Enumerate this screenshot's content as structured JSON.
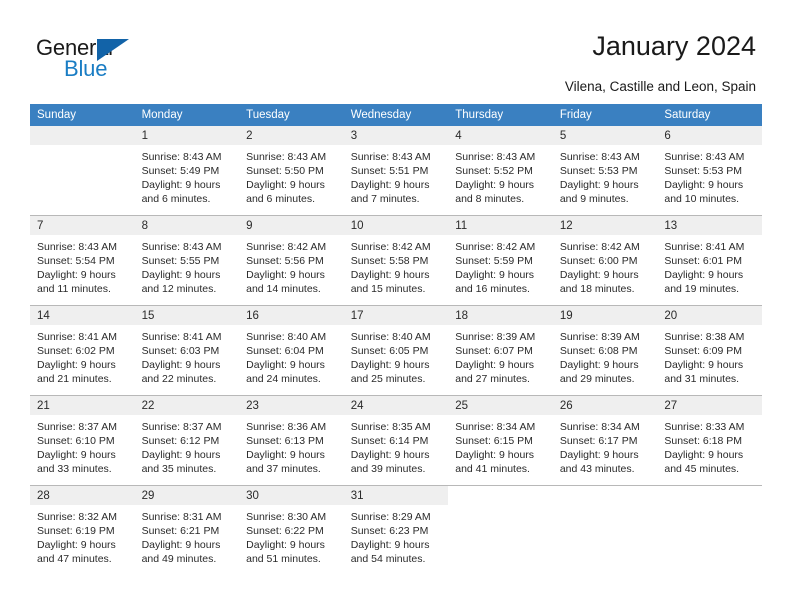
{
  "brand": {
    "name_part1": "General",
    "name_part2": "Blue",
    "triangle_color": "#1263a8",
    "blue_color": "#1a7dc4"
  },
  "header": {
    "title": "January 2024",
    "subtitle": "Vilena, Castille and Leon, Spain"
  },
  "theme": {
    "header_row_bg": "#3a80c1",
    "daynum_bg": "#efefef",
    "grid_line": "#b8b8b8",
    "text": "#2a2a2a"
  },
  "weekdays": [
    "Sunday",
    "Monday",
    "Tuesday",
    "Wednesday",
    "Thursday",
    "Friday",
    "Saturday"
  ],
  "weeks": [
    [
      {
        "day": "",
        "detail": "",
        "empty": true
      },
      {
        "day": "1",
        "detail": "Sunrise: 8:43 AM\nSunset: 5:49 PM\nDaylight: 9 hours\nand 6 minutes."
      },
      {
        "day": "2",
        "detail": "Sunrise: 8:43 AM\nSunset: 5:50 PM\nDaylight: 9 hours\nand 6 minutes."
      },
      {
        "day": "3",
        "detail": "Sunrise: 8:43 AM\nSunset: 5:51 PM\nDaylight: 9 hours\nand 7 minutes."
      },
      {
        "day": "4",
        "detail": "Sunrise: 8:43 AM\nSunset: 5:52 PM\nDaylight: 9 hours\nand 8 minutes."
      },
      {
        "day": "5",
        "detail": "Sunrise: 8:43 AM\nSunset: 5:53 PM\nDaylight: 9 hours\nand 9 minutes."
      },
      {
        "day": "6",
        "detail": "Sunrise: 8:43 AM\nSunset: 5:53 PM\nDaylight: 9 hours\nand 10 minutes."
      }
    ],
    [
      {
        "day": "7",
        "detail": "Sunrise: 8:43 AM\nSunset: 5:54 PM\nDaylight: 9 hours\nand 11 minutes."
      },
      {
        "day": "8",
        "detail": "Sunrise: 8:43 AM\nSunset: 5:55 PM\nDaylight: 9 hours\nand 12 minutes."
      },
      {
        "day": "9",
        "detail": "Sunrise: 8:42 AM\nSunset: 5:56 PM\nDaylight: 9 hours\nand 14 minutes."
      },
      {
        "day": "10",
        "detail": "Sunrise: 8:42 AM\nSunset: 5:58 PM\nDaylight: 9 hours\nand 15 minutes."
      },
      {
        "day": "11",
        "detail": "Sunrise: 8:42 AM\nSunset: 5:59 PM\nDaylight: 9 hours\nand 16 minutes."
      },
      {
        "day": "12",
        "detail": "Sunrise: 8:42 AM\nSunset: 6:00 PM\nDaylight: 9 hours\nand 18 minutes."
      },
      {
        "day": "13",
        "detail": "Sunrise: 8:41 AM\nSunset: 6:01 PM\nDaylight: 9 hours\nand 19 minutes."
      }
    ],
    [
      {
        "day": "14",
        "detail": "Sunrise: 8:41 AM\nSunset: 6:02 PM\nDaylight: 9 hours\nand 21 minutes."
      },
      {
        "day": "15",
        "detail": "Sunrise: 8:41 AM\nSunset: 6:03 PM\nDaylight: 9 hours\nand 22 minutes."
      },
      {
        "day": "16",
        "detail": "Sunrise: 8:40 AM\nSunset: 6:04 PM\nDaylight: 9 hours\nand 24 minutes."
      },
      {
        "day": "17",
        "detail": "Sunrise: 8:40 AM\nSunset: 6:05 PM\nDaylight: 9 hours\nand 25 minutes."
      },
      {
        "day": "18",
        "detail": "Sunrise: 8:39 AM\nSunset: 6:07 PM\nDaylight: 9 hours\nand 27 minutes."
      },
      {
        "day": "19",
        "detail": "Sunrise: 8:39 AM\nSunset: 6:08 PM\nDaylight: 9 hours\nand 29 minutes."
      },
      {
        "day": "20",
        "detail": "Sunrise: 8:38 AM\nSunset: 6:09 PM\nDaylight: 9 hours\nand 31 minutes."
      }
    ],
    [
      {
        "day": "21",
        "detail": "Sunrise: 8:37 AM\nSunset: 6:10 PM\nDaylight: 9 hours\nand 33 minutes."
      },
      {
        "day": "22",
        "detail": "Sunrise: 8:37 AM\nSunset: 6:12 PM\nDaylight: 9 hours\nand 35 minutes."
      },
      {
        "day": "23",
        "detail": "Sunrise: 8:36 AM\nSunset: 6:13 PM\nDaylight: 9 hours\nand 37 minutes."
      },
      {
        "day": "24",
        "detail": "Sunrise: 8:35 AM\nSunset: 6:14 PM\nDaylight: 9 hours\nand 39 minutes."
      },
      {
        "day": "25",
        "detail": "Sunrise: 8:34 AM\nSunset: 6:15 PM\nDaylight: 9 hours\nand 41 minutes."
      },
      {
        "day": "26",
        "detail": "Sunrise: 8:34 AM\nSunset: 6:17 PM\nDaylight: 9 hours\nand 43 minutes."
      },
      {
        "day": "27",
        "detail": "Sunrise: 8:33 AM\nSunset: 6:18 PM\nDaylight: 9 hours\nand 45 minutes."
      }
    ],
    [
      {
        "day": "28",
        "detail": "Sunrise: 8:32 AM\nSunset: 6:19 PM\nDaylight: 9 hours\nand 47 minutes."
      },
      {
        "day": "29",
        "detail": "Sunrise: 8:31 AM\nSunset: 6:21 PM\nDaylight: 9 hours\nand 49 minutes."
      },
      {
        "day": "30",
        "detail": "Sunrise: 8:30 AM\nSunset: 6:22 PM\nDaylight: 9 hours\nand 51 minutes."
      },
      {
        "day": "31",
        "detail": "Sunrise: 8:29 AM\nSunset: 6:23 PM\nDaylight: 9 hours\nand 54 minutes."
      },
      {
        "day": "",
        "detail": "",
        "empty": true,
        "nofill": true
      },
      {
        "day": "",
        "detail": "",
        "empty": true,
        "nofill": true
      },
      {
        "day": "",
        "detail": "",
        "empty": true,
        "nofill": true
      }
    ]
  ]
}
